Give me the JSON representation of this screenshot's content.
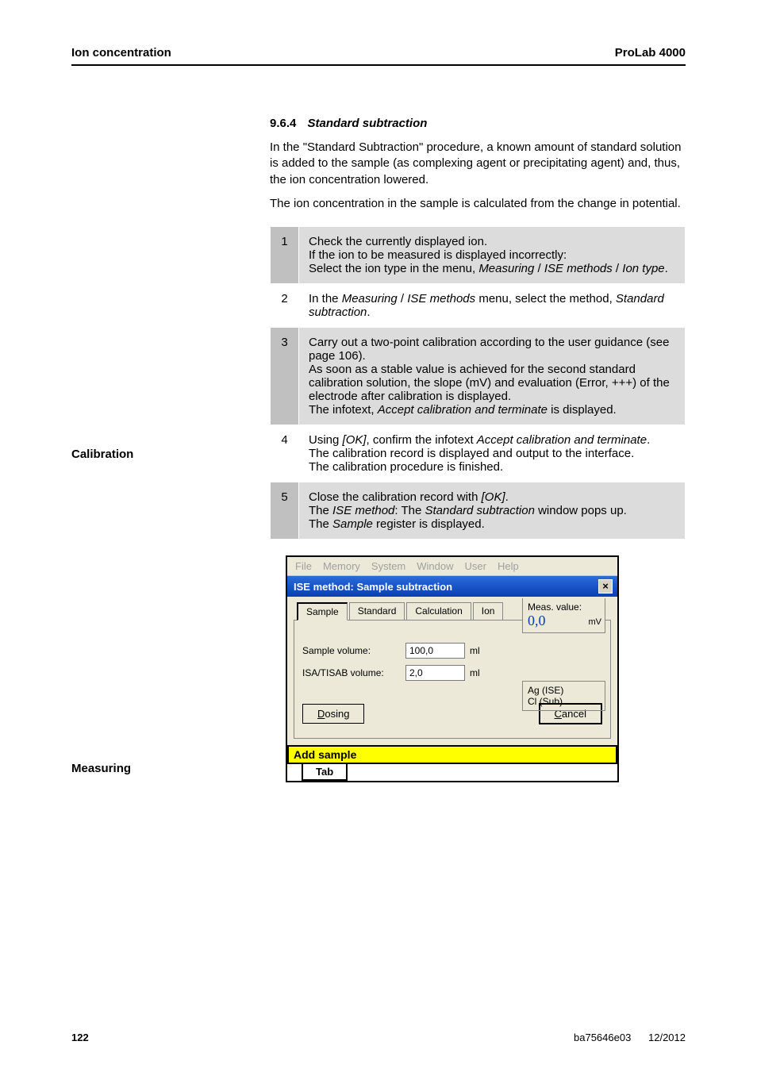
{
  "header": {
    "left": "Ion concentration",
    "right": "ProLab 4000"
  },
  "section": {
    "num": "9.6.4",
    "title": "Standard subtraction"
  },
  "para1": "In the \"Standard Subtraction\" procedure, a known amount of standard solution is added to the sample (as complexing agent or precipitating agent) and, thus, the ion concentration lowered.",
  "para2": "The ion concentration in the sample is calculated from the change in potential.",
  "side_calibration": "Calibration",
  "side_measuring": "Measuring",
  "steps": [
    {
      "n": "1",
      "html": "Check the currently displayed ion.<br>If the ion to be measured is displayed incorrectly:<br>Select the ion type in the menu, <span class=\"italic\">Measuring</span> / <span class=\"italic\">ISE methods</span> / <span class=\"italic\">Ion type</span>."
    },
    {
      "n": "2",
      "html": "In the <span class=\"italic\">Measuring</span> / <span class=\"italic\">ISE methods</span> menu, select the method, <span class=\"italic\">Standard subtraction</span>."
    },
    {
      "n": "3",
      "html": "Carry out a two-point calibration according to the user guidance (see page 106).<br>As soon as a stable value is achieved for the second standard calibration solution, the slope (mV) and evaluation (Error, +++) of the electrode after calibration is displayed.<br>The infotext, <span class=\"italic\">Accept calibration and terminate</span> is displayed."
    },
    {
      "n": "4",
      "html": "Using <span class=\"italic\">[OK]</span>, confirm the infotext <span class=\"italic\">Accept calibration and terminate</span>.<br>The calibration record is displayed and output to the interface.<br>The calibration procedure is finished."
    },
    {
      "n": "5",
      "html": "Close the calibration record with <span class=\"italic\">[OK]</span>.<br>The <span class=\"italic\">ISE method</span>: The <span class=\"italic\">Standard subtraction</span> window pops up.<br>The <span class=\"italic\">Sample</span> register is displayed."
    }
  ],
  "dialog": {
    "menus": [
      "File",
      "Memory",
      "System",
      "Window",
      "User",
      "Help"
    ],
    "title": "ISE method:  Sample subtraction",
    "tabs": [
      "Sample",
      "Standard",
      "Calculation",
      "Ion"
    ],
    "meas_label": "Meas. value:",
    "meas_value": "0,0",
    "meas_unit": "mV",
    "sample_volume_label": "Sample volume:",
    "sample_volume_value": "100,0",
    "sample_volume_unit": "ml",
    "isa_label": "ISA/TISAB volume:",
    "isa_value": "2,0",
    "isa_unit": "ml",
    "sensor_line1": "Ag (ISE)",
    "sensor_line2": "Cl (Sub)",
    "dosing": "Dosing",
    "cancel": "Cancel",
    "status": "Add sample",
    "bottom_tab": "Tab"
  },
  "footer": {
    "page": "122",
    "doc": "ba75646e03",
    "date": "12/2012"
  }
}
